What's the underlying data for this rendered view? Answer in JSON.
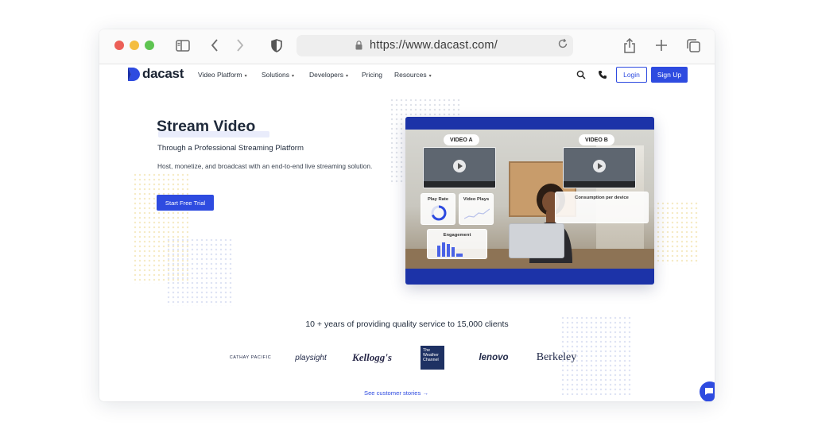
{
  "browser": {
    "url": "https://www.dacast.com/"
  },
  "site": {
    "logo_text": "dacast",
    "nav": [
      {
        "label": "Video Platform",
        "has_caret": true
      },
      {
        "label": "Solutions",
        "has_caret": true
      },
      {
        "label": "Developers",
        "has_caret": true
      },
      {
        "label": "Pricing",
        "has_caret": false
      },
      {
        "label": "Resources",
        "has_caret": true
      }
    ],
    "login_label": "Login",
    "signup_label": "Sign Up"
  },
  "hero": {
    "title": "Stream Video",
    "subtitle": "Through a Professional Streaming Platform",
    "body": "Host, monetize, and broadcast with an end-to-end live streaming solution.",
    "cta_label": "Start Free Trial"
  },
  "visual": {
    "video_a_label": "VIDEO A",
    "video_b_label": "VIDEO B",
    "play_rate_label": "Play Rate",
    "video_plays_label": "Video Plays",
    "consumption_label": "Consumption per device",
    "engagement_label": "Engagement"
  },
  "clients": {
    "title": "10 + years of providing quality service to 15,000 clients",
    "logos": [
      "CATHAY PACIFIC",
      "playsight",
      "Kellogg's",
      "The Weather Channel",
      "lenovo",
      "Berkeley"
    ],
    "stories_label": "See customer stories"
  },
  "colors": {
    "brand_blue": "#2e4be0",
    "visual_frame": "#1c33a8"
  }
}
